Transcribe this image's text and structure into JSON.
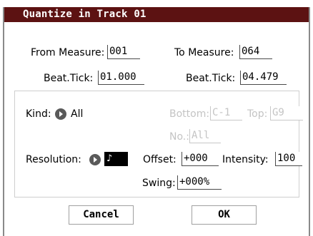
{
  "title": "Quantize in Track 01",
  "from_measure": {
    "label": "From Measure:",
    "value": "001"
  },
  "to_measure": {
    "label": "To Measure:",
    "value": "064"
  },
  "from_beat_tick": {
    "label": "Beat.Tick:",
    "value": "01.000"
  },
  "to_beat_tick": {
    "label": "Beat.Tick:",
    "value": "04.479"
  },
  "kind": {
    "label": "Kind:",
    "value": "All"
  },
  "bottom": {
    "label": "Bottom:",
    "value": "C-1"
  },
  "top": {
    "label": "Top:",
    "value": "G9"
  },
  "number": {
    "label": "No.:",
    "value": "All"
  },
  "resolution": {
    "label": "Resolution:",
    "value": "♪"
  },
  "offset": {
    "label": "Offset:",
    "value": "+000"
  },
  "intensity": {
    "label": "Intensity:",
    "value": "100"
  },
  "swing": {
    "label": "Swing:",
    "value": "+000%"
  },
  "buttons": {
    "cancel": "Cancel",
    "ok": "OK"
  },
  "colors": {
    "titlebar": "#5c1212",
    "disabled_text": "#c4c4c4",
    "border": "#8a8a8a"
  },
  "icons": {
    "kind_popup": "popup-arrow-icon",
    "resolution_popup": "popup-arrow-icon"
  }
}
